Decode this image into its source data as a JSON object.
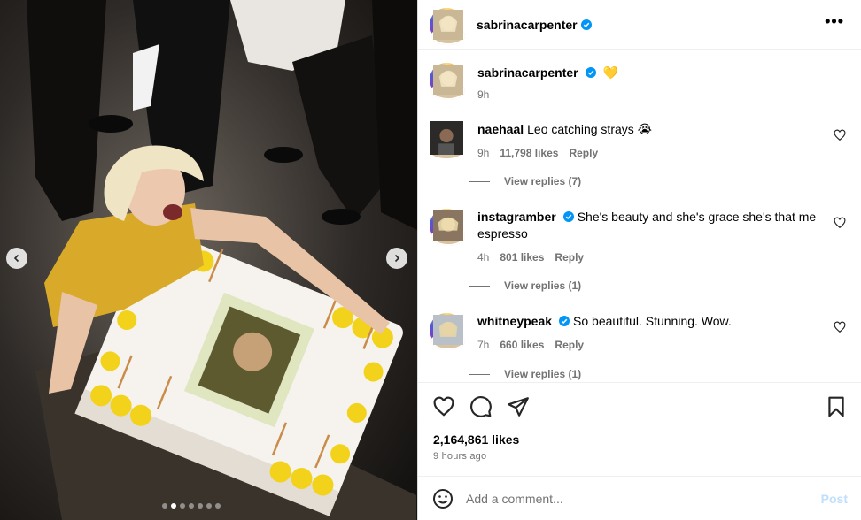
{
  "post": {
    "username": "sabrinacarpenter",
    "caption_emoji": "💛",
    "caption_time": "9h",
    "more_icon": "more-horizontal-icon"
  },
  "comments": [
    {
      "username": "naehaal",
      "text": "Leo catching strays 😭",
      "time": "9h",
      "likes": "11,798 likes",
      "reply": "Reply",
      "view_replies": "View replies (7)"
    },
    {
      "username": "instagramber",
      "verified": true,
      "text": "She's beauty and she's grace she's that me espresso",
      "time": "4h",
      "likes": "801 likes",
      "reply": "Reply",
      "view_replies": "View replies (1)"
    },
    {
      "username": "whitneypeak",
      "verified": true,
      "text": "So beautiful. Stunning. Wow.",
      "time": "7h",
      "likes": "660 likes",
      "reply": "Reply",
      "view_replies": "View replies (1)"
    }
  ],
  "footer": {
    "likes": "2,164,861 likes",
    "time_ago": "9 hours ago",
    "comment_placeholder": "Add a comment...",
    "post_label": "Post"
  },
  "carousel": {
    "slides": 7,
    "active_index": 0
  },
  "colors": {
    "verified": "#0095f6",
    "muted": "#737373",
    "post_disabled": "#c0dffd"
  }
}
